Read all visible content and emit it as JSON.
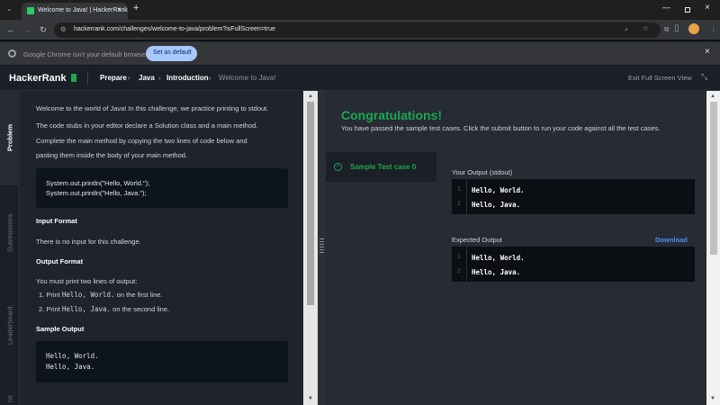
{
  "browser": {
    "tab_title": "Welcome to Java! | HackerRank",
    "url": "hackerrank.com/challenges/welcome-to-java/problem?isFullScreen=true",
    "infobar_text": "Google Chrome isn't your default browser",
    "set_default_label": "Set as default"
  },
  "header": {
    "logo": "HackerRank",
    "breadcrumb": [
      "Prepare",
      "Java",
      "Introduction",
      "Welcome to Java!"
    ],
    "exit_fullscreen": "Exit Full Screen View"
  },
  "side_tabs": [
    "Problem",
    "Submissions",
    "Leaderboard",
    "Discussions"
  ],
  "side_tab_visible": {
    "Discussions": "ns"
  },
  "problem": {
    "intro": "Welcome to the world of Java! In this challenge, we practice printing to stdout.",
    "desc_lines": [
      "The code stubs in your editor declare a Solution class and a main method.",
      "Complete the main method by copying the two lines of code below and",
      "pasting them inside the body of your main method."
    ],
    "code_lines": [
      "System.out.println(\"Hello, World.\");",
      "System.out.println(\"Hello, Java.\");"
    ],
    "input_format_heading": "Input Format",
    "input_format_text": "There is no input for this challenge.",
    "output_format_heading": "Output Format",
    "output_format_text": "You must print two lines of output:",
    "output_items": [
      {
        "num": "1.",
        "pre": "Print ",
        "code": "Hello, World.",
        "post": " on the first line."
      },
      {
        "num": "2.",
        "pre": "Print ",
        "code": "Hello, Java.",
        "post": " on the second line."
      }
    ],
    "sample_output_heading": "Sample Output",
    "sample_output_lines": [
      "Hello, World.",
      "Hello, Java."
    ]
  },
  "result": {
    "title": "Congratulations!",
    "subtitle": "You have passed the sample test cases. Click the submit button to run your code against all the test cases.",
    "test_case_label": "Sample Test case 0",
    "your_output_label": "Your Output (stdout)",
    "your_output_lines": [
      {
        "n": "1",
        "text": "Hello, World."
      },
      {
        "n": "2",
        "text": "Hello, Java."
      }
    ],
    "expected_output_label": "Expected Output",
    "download_label": "Download",
    "expected_output_lines": [
      {
        "n": "1",
        "text": "Hello, World."
      },
      {
        "n": "2",
        "text": "Hello, Java."
      }
    ]
  },
  "colors": {
    "success": "#1ba94c",
    "link": "#4f8ff7",
    "brand_dark": "#0e141e"
  }
}
